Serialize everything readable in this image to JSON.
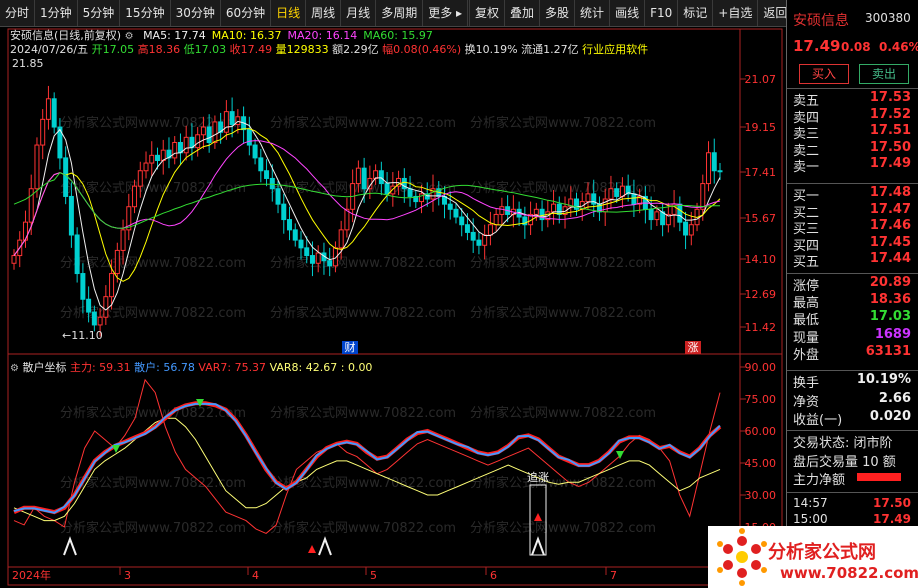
{
  "toolbar": {
    "left": [
      "分时",
      "1分钟",
      "5分钟",
      "15分钟",
      "30分钟",
      "60分钟",
      "日线",
      "周线",
      "月线",
      "多周期",
      "更多"
    ],
    "active": "日线",
    "right": [
      "复权",
      "叠加",
      "多股",
      "统计",
      "画线",
      "F10",
      "标记",
      "+自选",
      "返回"
    ]
  },
  "chart": {
    "title": "安硕信息(日线,前复权)",
    "ma": [
      {
        "label": "MA5: 17.74",
        "color": "#f0f0f0"
      },
      {
        "label": "MA10: 16.37",
        "color": "#ffff00"
      },
      {
        "label": "MA20: 16.14",
        "color": "#ff44ff"
      },
      {
        "label": "MA60: 15.97",
        "color": "#33dd33"
      }
    ],
    "date": "2024/07/26/五",
    "open_label": "开",
    "open": "17.05",
    "high_label": "高",
    "high": "18.36",
    "low_label": "低",
    "low": "17.03",
    "close_label": "收",
    "close": "17.49",
    "vol_label": "量",
    "vol": "129833",
    "amt_label": "额",
    "amt": "2.29亿",
    "chg_label": "幅",
    "chg": "0.08(0.46%)",
    "turn": "换10.19%",
    "float": "流通1.27亿",
    "industry": "行业应用软件",
    "price_axis": [
      "21.07",
      "19.15",
      "17.41",
      "15.67",
      "14.10",
      "12.69",
      "11.42"
    ],
    "high_mark": "21.85",
    "low_mark": "←11.10",
    "cai": "财",
    "zhang": "涨"
  },
  "indicator": {
    "name": "散户坐标",
    "zl_label": "主力: 59.31",
    "sh_label": "散户: 56.78",
    "var7_label": "VAR7: 75.37",
    "var8_label": "VAR8: 42.67 : 0.00",
    "axis": [
      "90.00",
      "75.00",
      "60.00",
      "45.00",
      "30.00",
      "15.00"
    ],
    "zhuizhang": "追涨"
  },
  "xaxis": [
    "2024年",
    "3",
    "4",
    "5",
    "6",
    "7"
  ],
  "watermark": "分析家公式网www.70822.com",
  "panel": {
    "name": "安硕信息",
    "code": "300380",
    "price": "17.49",
    "change": "0.08",
    "pct": "0.46%",
    "buy": "买入",
    "sell": "卖出",
    "asks": [
      {
        "label": "卖五",
        "val": "17.53"
      },
      {
        "label": "卖四",
        "val": "17.52"
      },
      {
        "label": "卖三",
        "val": "17.51"
      },
      {
        "label": "卖二",
        "val": "17.50"
      },
      {
        "label": "卖一",
        "val": "17.49"
      }
    ],
    "bids": [
      {
        "label": "买一",
        "val": "17.48"
      },
      {
        "label": "买二",
        "val": "17.47"
      },
      {
        "label": "买三",
        "val": "17.46"
      },
      {
        "label": "买四",
        "val": "17.45"
      },
      {
        "label": "买五",
        "val": "17.44"
      }
    ],
    "stats": [
      {
        "label": "涨停",
        "val": "20.89",
        "cls": "red"
      },
      {
        "label": "最高",
        "val": "18.36",
        "cls": "red"
      },
      {
        "label": "最低",
        "val": "17.03",
        "cls": "green"
      },
      {
        "label": "现量",
        "val": "1689",
        "cls": "purple"
      },
      {
        "label": "外盘",
        "val": "63131",
        "cls": "red"
      }
    ],
    "extra": [
      {
        "label": "换手",
        "val": "10.19%"
      },
      {
        "label": "净资",
        "val": "2.66"
      },
      {
        "label": "收益(一)",
        "val": "0.020"
      }
    ],
    "status": "交易状态: 闭市阶",
    "after": "盘后交易量 10 额",
    "netflow": "主力净额",
    "ticks": [
      {
        "time": "14:57",
        "val": "17.50"
      },
      {
        "time": "15:00",
        "val": "17.49"
      }
    ]
  },
  "logo": {
    "main": "分析家公式网",
    "sub": "www.70822.com"
  }
}
